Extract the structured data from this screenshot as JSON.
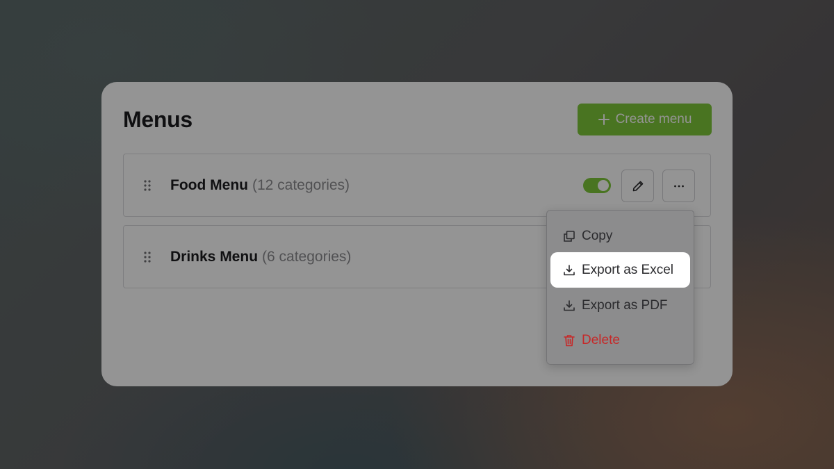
{
  "header": {
    "title": "Menus",
    "create_button_label": "Create menu"
  },
  "menus": [
    {
      "name": "Food Menu",
      "count_label": "(12 categories)",
      "enabled": true
    },
    {
      "name": "Drinks Menu",
      "count_label": "(6 categories)"
    }
  ],
  "dropdown": {
    "items": [
      {
        "label": "Copy",
        "icon": "copy-icon"
      },
      {
        "label": "Export as Excel",
        "icon": "download-icon",
        "highlighted": true
      },
      {
        "label": "Export as PDF",
        "icon": "download-icon"
      },
      {
        "label": "Delete",
        "icon": "trash-icon",
        "destructive": true
      }
    ]
  },
  "colors": {
    "accent": "#7fc93a",
    "danger": "#c62828",
    "text": "#1d1d1f",
    "muted": "#8c8c90"
  }
}
